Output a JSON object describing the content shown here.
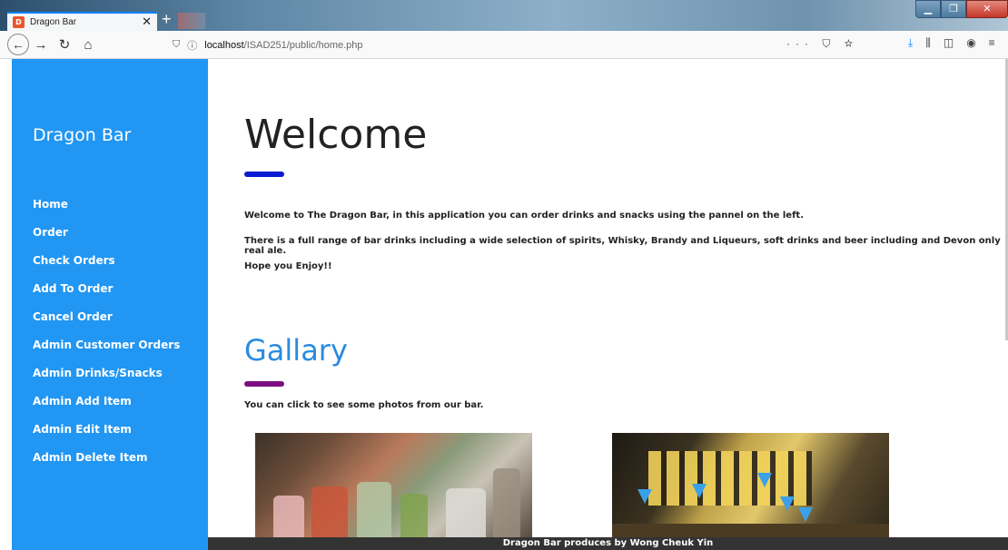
{
  "browser": {
    "tab_title": "Dragon Bar",
    "tab_icon": "app-favicon",
    "url_host": "localhost",
    "url_path": "/ISAD251/public/home.php",
    "page_actions": "··· ⛉ ☆"
  },
  "sidebar": {
    "brand": "Dragon Bar",
    "items": [
      {
        "label": "Home"
      },
      {
        "label": "Order"
      },
      {
        "label": "Check Orders"
      },
      {
        "label": "Add To Order"
      },
      {
        "label": "Cancel Order"
      },
      {
        "label": "Admin Customer Orders"
      },
      {
        "label": "Admin Drinks/Snacks"
      },
      {
        "label": "Admin Add Item"
      },
      {
        "label": "Admin Edit Item"
      },
      {
        "label": "Admin Delete Item"
      }
    ]
  },
  "main": {
    "welcome_title": "Welcome",
    "para1": "Welcome to The Dragon Bar, in this application you can order drinks and snacks using the pannel on the left.",
    "para2": "There is a full range of bar drinks including a wide selection of spirits, Whisky, Brandy and Liqueurs, soft drinks and beer including and Devon only real ale.",
    "para3": "Hope you Enjoy!!",
    "gallery_title": "Gallary",
    "gallery_text": "You can click to see some photos from our bar."
  },
  "footer": {
    "text": "Dragon Bar produces by Wong Cheuk Yin"
  },
  "colors": {
    "sidebar": "#2196f3",
    "welcome_bar": "#0b1bd1",
    "gallery_title": "#2a8be0",
    "gallery_bar": "#7b0f82"
  }
}
